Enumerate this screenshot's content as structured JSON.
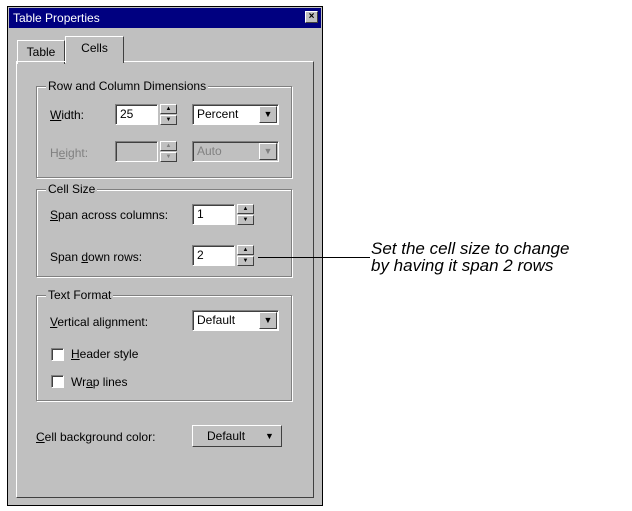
{
  "window": {
    "title": "Table Properties",
    "close_glyph": "×"
  },
  "tabs": [
    {
      "label": "Table"
    },
    {
      "label": "Cells",
      "active": true
    }
  ],
  "row_col": {
    "legend": "Row and Column Dimensions",
    "width_label_u": "W",
    "width_label_rest": "idth:",
    "width_value": "25",
    "width_unit": "Percent",
    "height_label_pre": "H",
    "height_label_u": "e",
    "height_label_rest": "ight:",
    "height_value": "",
    "height_unit": "Auto"
  },
  "cell_size": {
    "legend": "Cell Size",
    "span_cols_u": "S",
    "span_cols_rest": "pan across columns:",
    "span_cols_value": "1",
    "span_rows_pre": "Span ",
    "span_rows_u": "d",
    "span_rows_rest": "own rows:",
    "span_rows_value": "2"
  },
  "text_format": {
    "legend": "Text Format",
    "valign_u": "V",
    "valign_rest": "ertical alignment:",
    "valign_value": "Default",
    "header_u": "H",
    "header_rest": "eader style",
    "header_checked": false,
    "wrap_pre": "Wr",
    "wrap_u": "a",
    "wrap_rest": "p lines",
    "wrap_checked": false
  },
  "background": {
    "label_u": "C",
    "label_rest": "ell background color:",
    "button_label": "Default"
  },
  "annotation": {
    "line1": "Set the cell size to change",
    "line2": "by having it span 2 rows"
  },
  "colors": {
    "titlebar": "#000080",
    "face": "#c0c0c0"
  },
  "icons": {
    "close": "close-icon",
    "spin_up": "up-arrow-icon",
    "spin_down": "down-arrow-icon",
    "dropdown": "dropdown-arrow-icon"
  }
}
